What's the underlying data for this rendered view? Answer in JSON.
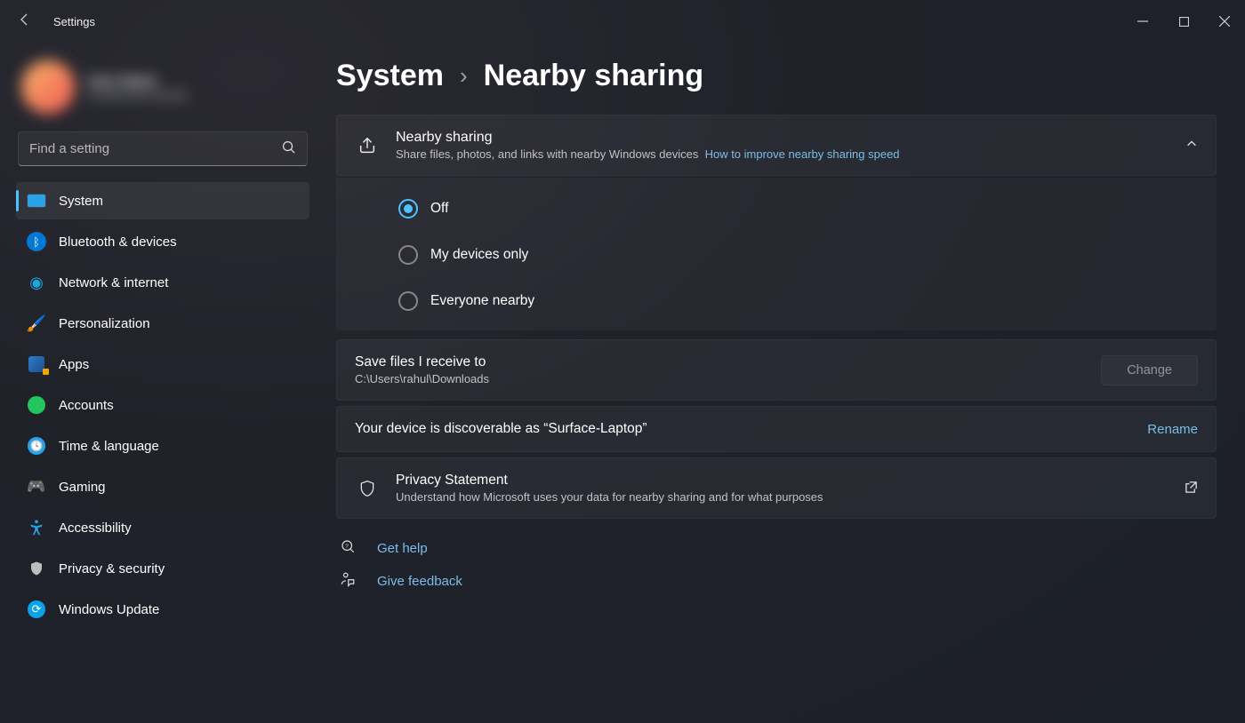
{
  "titlebar": {
    "app_title": "Settings"
  },
  "user": {
    "name": "User Name",
    "email": "user@email.example"
  },
  "search": {
    "placeholder": "Find a setting"
  },
  "sidebar": {
    "items": [
      {
        "label": "System"
      },
      {
        "label": "Bluetooth & devices"
      },
      {
        "label": "Network & internet"
      },
      {
        "label": "Personalization"
      },
      {
        "label": "Apps"
      },
      {
        "label": "Accounts"
      },
      {
        "label": "Time & language"
      },
      {
        "label": "Gaming"
      },
      {
        "label": "Accessibility"
      },
      {
        "label": "Privacy & security"
      },
      {
        "label": "Windows Update"
      }
    ]
  },
  "breadcrumb": {
    "parent": "System",
    "separator": "›",
    "current": "Nearby sharing"
  },
  "nearby": {
    "title": "Nearby sharing",
    "subtitle": "Share files, photos, and links with nearby Windows devices",
    "help_link": "How to improve nearby sharing speed",
    "options": [
      {
        "label": "Off"
      },
      {
        "label": "My devices only"
      },
      {
        "label": "Everyone nearby"
      }
    ]
  },
  "save": {
    "title": "Save files I receive to",
    "path": "C:\\Users\\rahul\\Downloads",
    "button": "Change"
  },
  "discover": {
    "text": "Your device is discoverable as “Surface-Laptop”",
    "action": "Rename"
  },
  "privacy": {
    "title": "Privacy Statement",
    "subtitle": "Understand how Microsoft uses your data for nearby sharing and for what purposes"
  },
  "footer": {
    "help": "Get help",
    "feedback": "Give feedback"
  }
}
